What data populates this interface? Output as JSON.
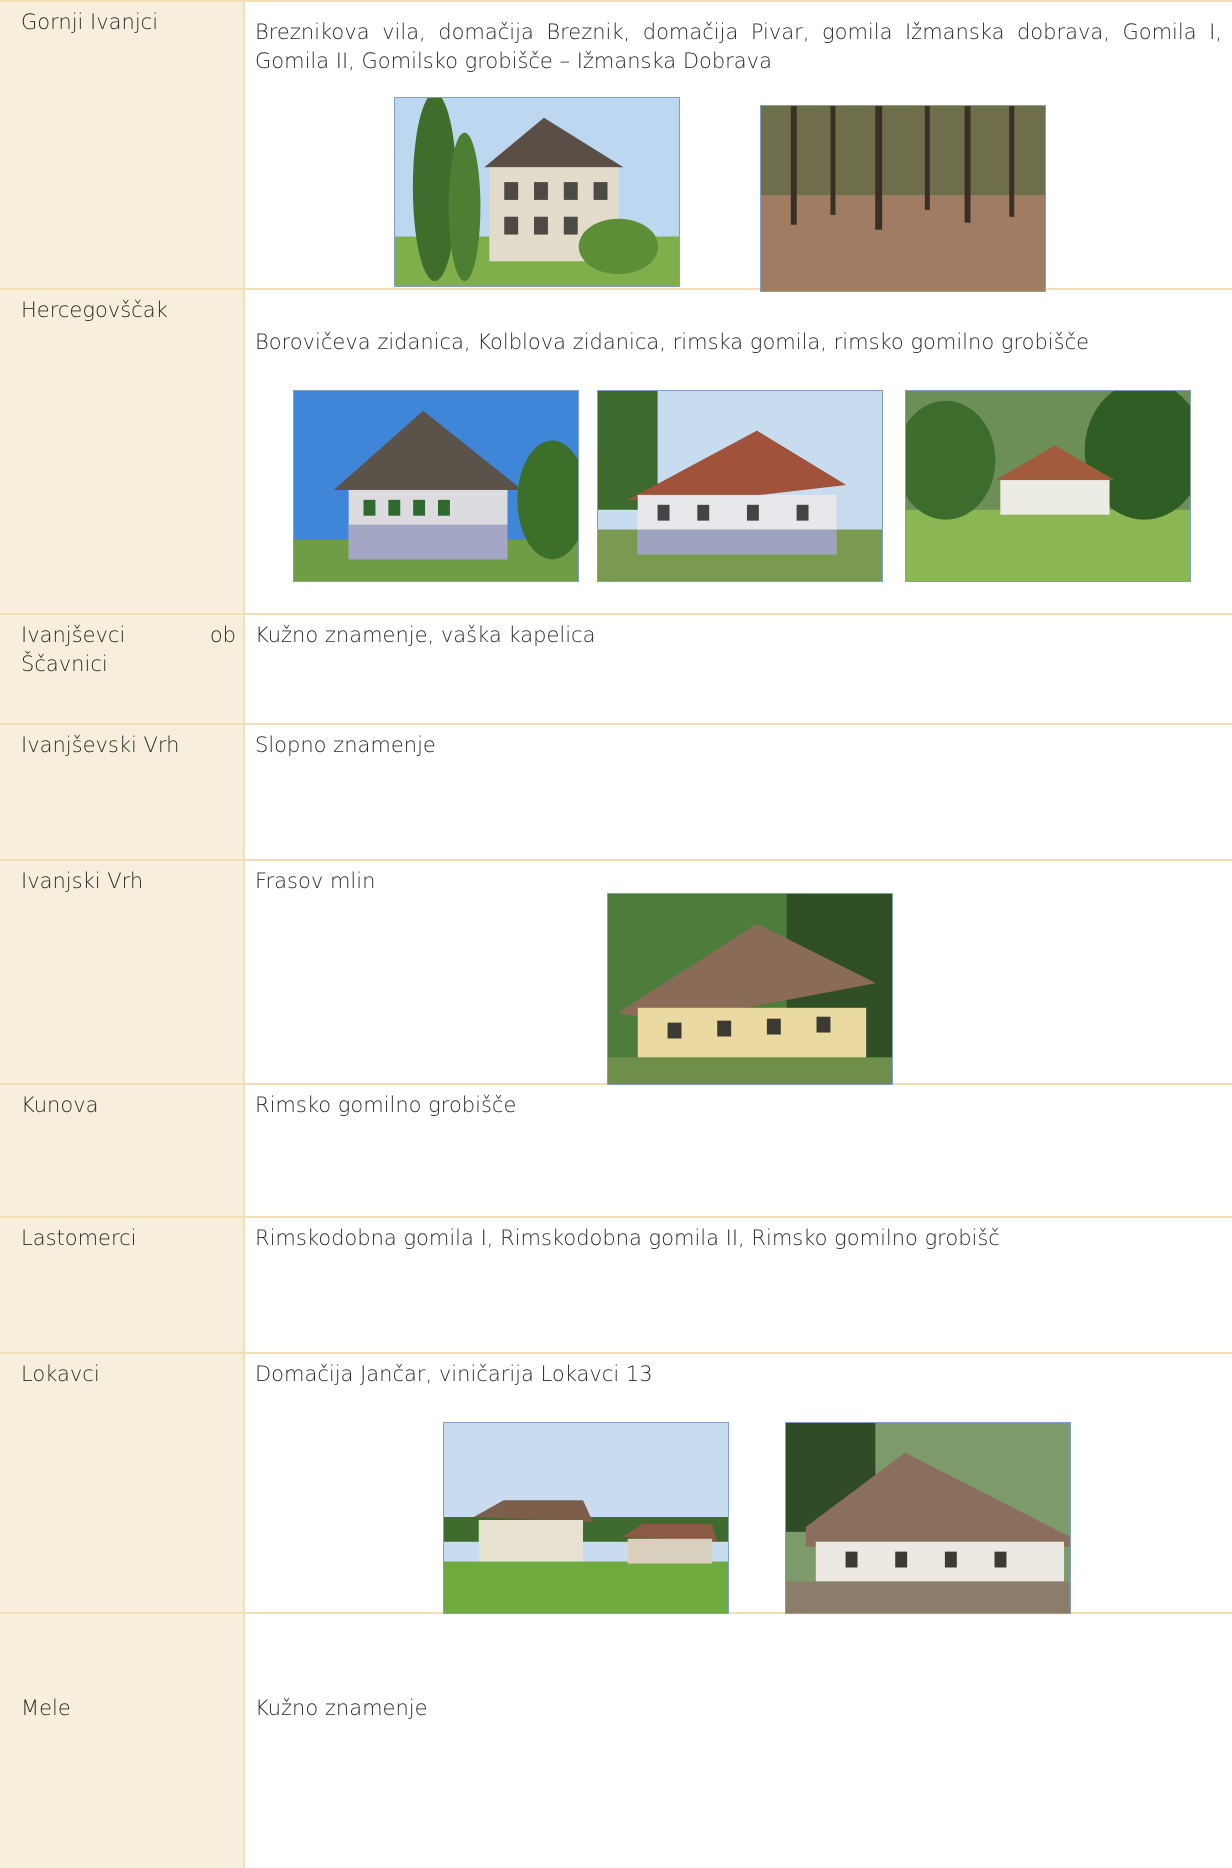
{
  "rows": [
    {
      "place": "Gornji Ivanjci",
      "desc": "Breznikova vila, domačija Breznik, domačija Pivar, gomila Ižmanska dobrava, Gomila I, Gomila II, Gomilsko grobišče – Ižmanska Dobrava"
    },
    {
      "place": "Hercegovščak",
      "desc": "Borovičeva zidanica, Kolblova zidanica, rimska gomila, rimsko gomilno grobišče"
    },
    {
      "place": "Ivanjševci ob Ščavnici",
      "desc": "Kužno znamenje, vaška kapelica"
    },
    {
      "place": "Ivanjševski Vrh",
      "desc": "Slopno znamenje"
    },
    {
      "place": "Ivanjski Vrh",
      "desc": "Frasov mlin"
    },
    {
      "place": "Kunova",
      "desc": "Rimsko gomilno grobišče"
    },
    {
      "place": "Lastomerci",
      "desc": "Rimskodobna gomila I, Rimskodobna gomila II, Rimsko gomilno grobišč"
    },
    {
      "place": "Lokavci",
      "desc": "Domačija Jančar, viničarija Lokavci 13"
    },
    {
      "place": "Mele",
      "desc": "Kužno znamenje"
    }
  ]
}
